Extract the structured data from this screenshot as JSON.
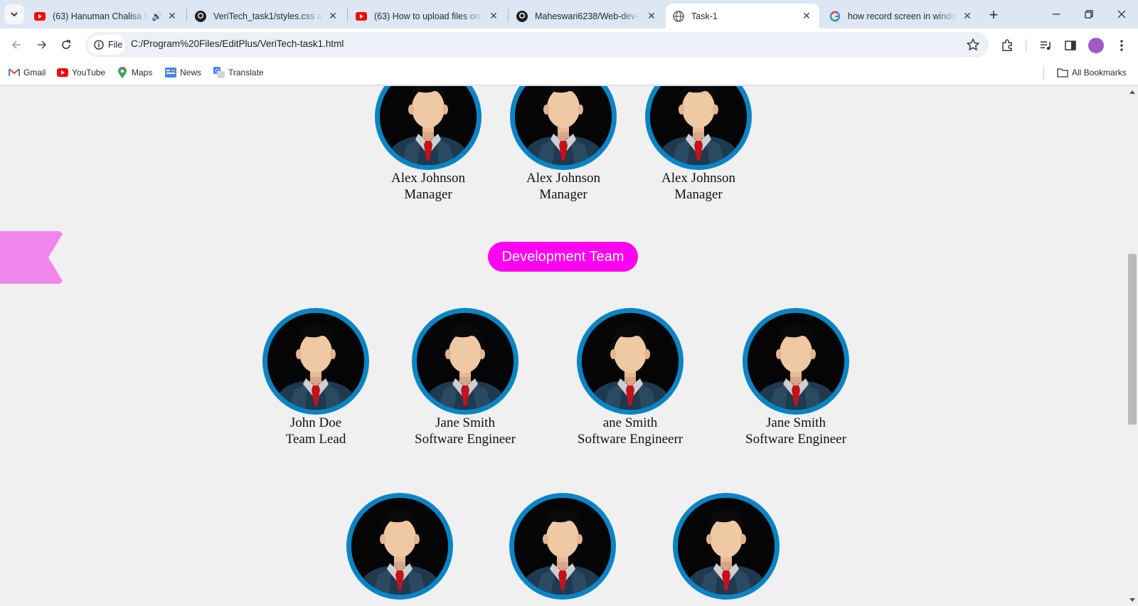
{
  "tabs": [
    {
      "title": "(63) Hanuman Chalisa M",
      "favicon": "youtube-icon",
      "audio": true
    },
    {
      "title": "VeriTech_task1/styles.css at m",
      "favicon": "github-icon"
    },
    {
      "title": "(63) How to upload files on G",
      "favicon": "youtube-icon"
    },
    {
      "title": "Maheswari6238/Web-dev-Ta",
      "favicon": "github-icon"
    },
    {
      "title": "Task-1",
      "favicon": "globe-icon",
      "active": true
    },
    {
      "title": "how record screen in window",
      "favicon": "google-icon"
    }
  ],
  "omnibox": {
    "chip_label": "File",
    "url": "C:/Program%20Files/EditPlus/VeriTech-task1.html"
  },
  "bookmarks": [
    {
      "label": "Gmail",
      "icon": "gmail-icon"
    },
    {
      "label": "YouTube",
      "icon": "youtube-icon"
    },
    {
      "label": "Maps",
      "icon": "maps-icon"
    },
    {
      "label": "News",
      "icon": "news-icon"
    },
    {
      "label": "Translate",
      "icon": "translate-icon"
    }
  ],
  "all_bookmarks_label": "All Bookmarks",
  "page": {
    "managers": [
      {
        "name": "Alex Johnson",
        "role": "Manager"
      },
      {
        "name": "Alex Johnson",
        "role": "Manager"
      },
      {
        "name": "Alex Johnson",
        "role": "Manager"
      }
    ],
    "team_heading": "Development Team",
    "dev_team": [
      {
        "name": "John Doe",
        "role": "Team Lead"
      },
      {
        "name": "Jane Smith",
        "role": "Software Engineer"
      },
      {
        "name": "ane Smith",
        "role": "Software Engineerr"
      },
      {
        "name": "Jane Smith",
        "role": "Software Engineer"
      }
    ]
  },
  "colors": {
    "accent_pill": "#ff00f2",
    "photo_ring": "#0a84c4",
    "ribbon": "#ef86ec"
  }
}
